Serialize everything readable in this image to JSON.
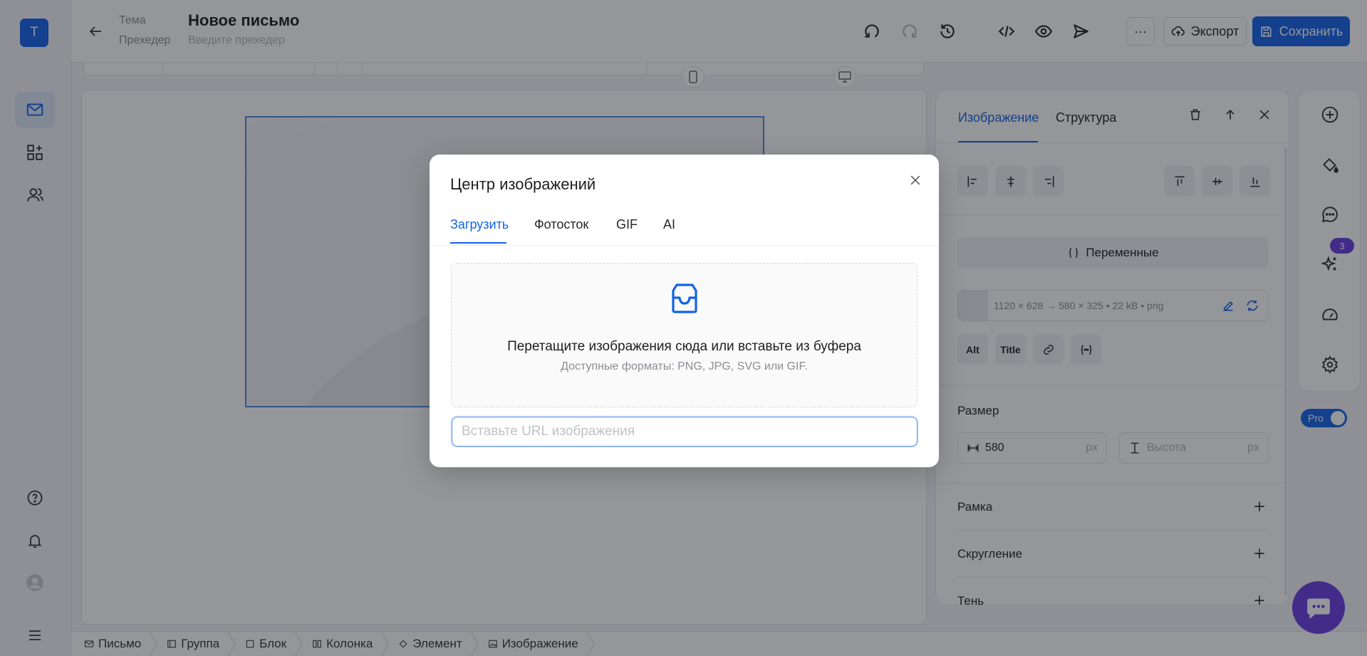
{
  "app": {
    "logo_letter": "T",
    "accent": "#1463e8",
    "brand_purple": "#6b3fe0"
  },
  "rail": {
    "items": [
      {
        "name": "mail-icon",
        "active": true
      },
      {
        "name": "blocks-icon",
        "active": false
      },
      {
        "name": "users-icon",
        "active": false
      }
    ],
    "bottom": [
      "help-icon",
      "bell-icon",
      "avatar",
      "menu-icon"
    ]
  },
  "header": {
    "subject_label": "Тема",
    "subject_value": "Новое письмо",
    "preheader_label": "Прехедер",
    "preheader_placeholder": "Введите прехедер",
    "more_label": "···",
    "export_label": "Экспорт",
    "save_label": "Сохранить"
  },
  "breadcrumb": [
    {
      "icon": "mail-icon",
      "label": "Письмо"
    },
    {
      "icon": "group-icon",
      "label": "Группа"
    },
    {
      "icon": "square-icon",
      "label": "Блок"
    },
    {
      "icon": "columns-icon",
      "label": "Колонка"
    },
    {
      "icon": "diamond-icon",
      "label": "Элемент"
    },
    {
      "icon": "image-icon",
      "label": "Изображение"
    }
  ],
  "panel": {
    "tabs": [
      "Изображение",
      "Структура"
    ],
    "active_tab": 0,
    "variables_label": "Переменные",
    "image_info": "1120 × 628 → 580 × 325  •  22 kB  •  png",
    "chip_alt": "Alt",
    "chip_title": "Title",
    "size_title": "Размер",
    "width_value": "580",
    "width_unit": "px",
    "height_placeholder": "Высота",
    "height_unit": "px",
    "sections": [
      "Рамка",
      "Скругление",
      "Тень"
    ]
  },
  "strip": {
    "badge": "3",
    "pro_label": "Pro"
  },
  "modal": {
    "title": "Центр изображений",
    "tabs": [
      "Загрузить",
      "Фотосток",
      "GIF",
      "AI"
    ],
    "active_tab": 0,
    "drop_text": "Перетащите изображения сюда или вставьте из буфера",
    "formats_text": "Доступные форматы: PNG, JPG, SVG или GIF.",
    "url_placeholder": "Вставьте URL изображения"
  }
}
